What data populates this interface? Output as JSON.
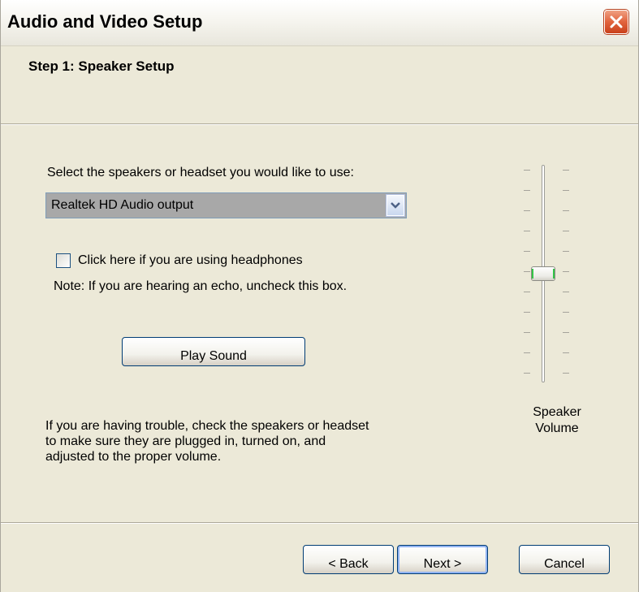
{
  "window": {
    "title": "Audio and Video Setup",
    "close_icon": "close-icon"
  },
  "header": {
    "step_title": "Step 1: Speaker Setup"
  },
  "content": {
    "select_prompt": "Select the speakers or headset you would like to use:",
    "device_select": {
      "value": "Realtek HD Audio output",
      "arrow_icon": "chevron-down-icon"
    },
    "headphones_checkbox": {
      "label": "Click here if you are using headphones",
      "checked": false
    },
    "echo_note": "Note: If you are hearing an echo, uncheck this box.",
    "play_sound_label": "Play Sound",
    "trouble_text": {
      "line1": "If you are having trouble, check the speakers or headset",
      "line2": "to make sure they are plugged in, turned on, and",
      "line3": "adjusted to the proper volume."
    },
    "volume_slider": {
      "label_line1": "Speaker",
      "label_line2": "Volume",
      "level_fraction": 0.5
    }
  },
  "footer": {
    "back_label": "< Back",
    "next_label": "Next >",
    "cancel_label": "Cancel"
  },
  "colors": {
    "dialog_bg": "#ece9d8",
    "close_button": "#e1633d",
    "default_button_ring": "#92b4f2",
    "slider_thumb_accent": "#35c548"
  }
}
